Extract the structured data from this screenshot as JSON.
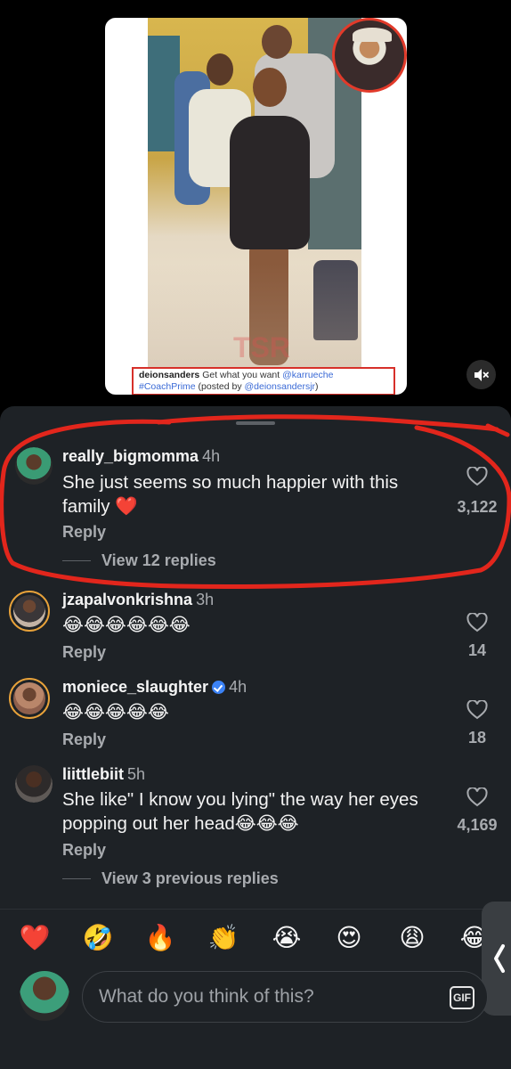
{
  "post": {
    "caption_user": "deionsanders",
    "caption_text": "Get what you want",
    "caption_mention": "@karrueche",
    "caption_hashtag": "#CoachPrime",
    "caption_posted_by": "(posted by",
    "caption_posted_handle": "@deionsandersjr",
    "caption_close": ")",
    "watermark": "TSR"
  },
  "comments": [
    {
      "username": "really_bigmomma",
      "time": "4h",
      "text": "She just seems so much happier with this family ❤️",
      "reply_label": "Reply",
      "likes": "3,122",
      "view_replies": "View 12 replies",
      "verified": false
    },
    {
      "username": "jzapalvonkrishna",
      "time": "3h",
      "text": "😂😂😂😂😂😂",
      "reply_label": "Reply",
      "likes": "14",
      "verified": false
    },
    {
      "username": "moniece_slaughter",
      "time": "4h",
      "text": "😂😂😂😂😂",
      "reply_label": "Reply",
      "likes": "18",
      "verified": true
    },
    {
      "username": "liittlebiit",
      "time": "5h",
      "text": "She like\" I know you lying\" the way her eyes popping out her head😂😂😂",
      "reply_label": "Reply",
      "likes": "4,169",
      "view_replies": "View 3 previous replies",
      "verified": false
    }
  ],
  "quick_emojis": [
    "❤️",
    "🤣",
    "🔥",
    "👏",
    "😭",
    "😍",
    "😩",
    "😂"
  ],
  "composer": {
    "placeholder": "What do you think of this?",
    "gif_label": "GIF"
  },
  "side_tab_icon": "chevron-left-icon",
  "colors": {
    "sheet_bg": "#1e2226",
    "annotation_red": "#e2261c",
    "muted_text": "#a8abaf",
    "verified_blue": "#3b82f6"
  }
}
